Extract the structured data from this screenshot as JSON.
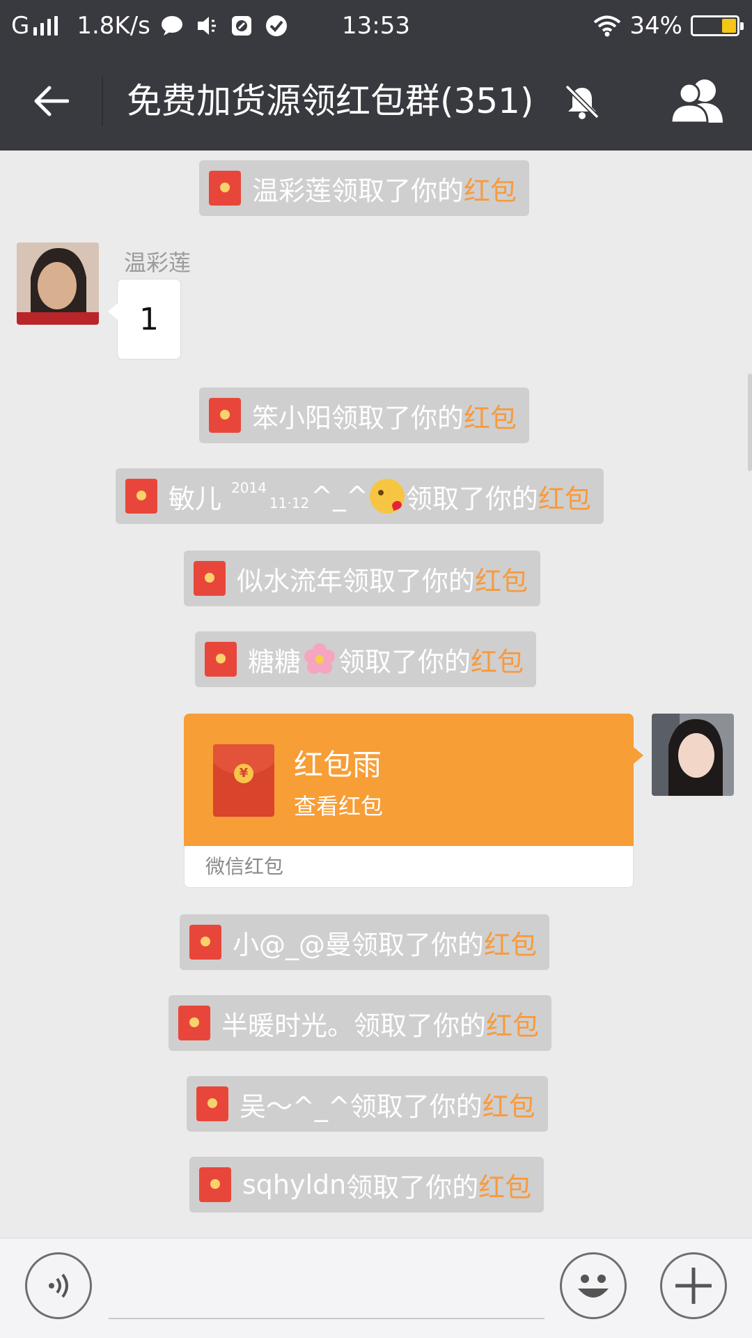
{
  "status_bar": {
    "carrier": "G",
    "net_speed": "1.8K/s",
    "time": "13:53",
    "battery": "34%",
    "battery_level": 0.34
  },
  "header": {
    "title": "免费加货源领红包群(351)"
  },
  "messages": {
    "sys1": {
      "name": "温彩莲",
      "action": "领取了你的",
      "packet": "红包"
    },
    "text_msg": {
      "sender": "温彩莲",
      "text": "1"
    },
    "sys2": {
      "name": "笨小阳",
      "action": "领取了你的",
      "packet": "红包"
    },
    "sys3": {
      "name": "敏儿",
      "sup": "2014",
      "sub": "11·12",
      "tail": "^_^",
      "action": "领取了你的",
      "packet": "红包"
    },
    "sys4": {
      "name": "似水流年",
      "action": "领取了你的",
      "packet": "红包"
    },
    "sys5": {
      "name": "糖糖",
      "action": "领取了你的",
      "packet": "红包"
    },
    "red_packet": {
      "title": "红包雨",
      "subtitle": "查看红包",
      "footer": "微信红包"
    },
    "sys6": {
      "name": "小@_@曼",
      "action": "领取了你的",
      "packet": "红包"
    },
    "sys7": {
      "name": "半暖时光。",
      "action": "领取了你的",
      "packet": "红包"
    },
    "sys8": {
      "name": "吴～^_^",
      "action": "领取了你的",
      "packet": "红包"
    },
    "sys9": {
      "name": "sqhyldn",
      "action": "领取了你的",
      "packet": "红包"
    }
  },
  "icons": {
    "back": "back-arrow-icon",
    "mute": "muted-bell-icon",
    "members": "group-members-icon",
    "voice": "voice-icon",
    "emoji": "emoji-icon",
    "plus": "plus-icon"
  },
  "colors": {
    "header_bg": "#393a3f",
    "chat_bg": "#ebebeb",
    "highlight": "#f89a3c",
    "packet_orange": "#f79e36",
    "envelope_red": "#e9463b"
  }
}
